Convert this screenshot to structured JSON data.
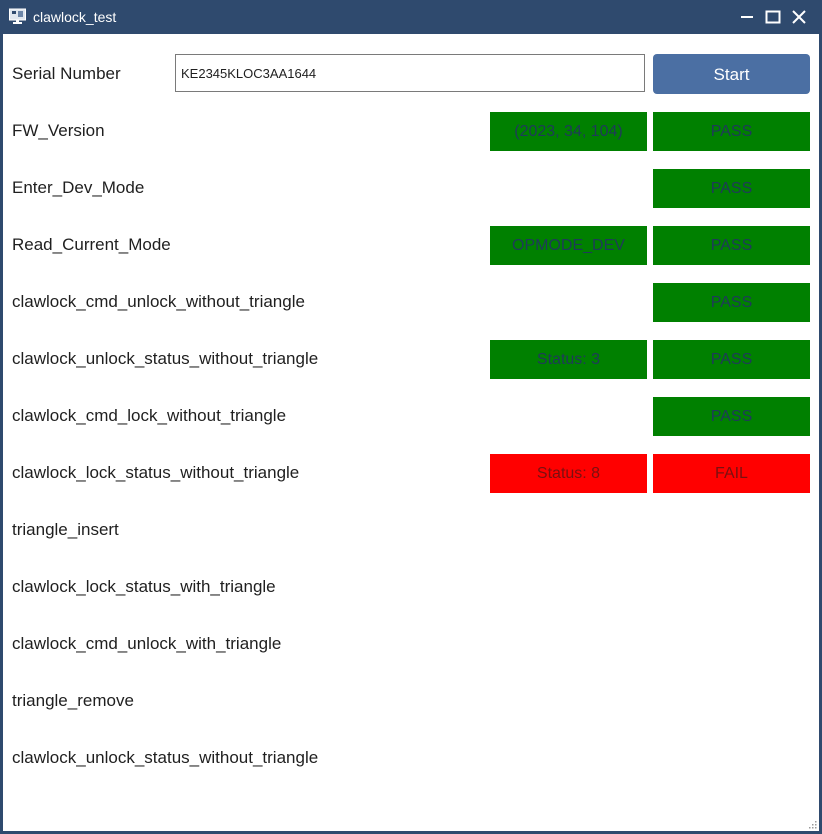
{
  "window": {
    "title": "clawlock_test",
    "icon": "app-monitor-icon",
    "controls": [
      "minimize-icon",
      "maximize-icon",
      "close-icon"
    ]
  },
  "serial": {
    "label": "Serial Number",
    "value": "KE2345KLOC3AA1644",
    "start_label": "Start"
  },
  "tests": [
    {
      "name": "FW_Version",
      "value": "(2023, 34, 104)",
      "result": "PASS"
    },
    {
      "name": "Enter_Dev_Mode",
      "value": "",
      "result": "PASS"
    },
    {
      "name": "Read_Current_Mode",
      "value": "OPMODE_DEV",
      "result": "PASS"
    },
    {
      "name": "clawlock_cmd_unlock_without_triangle",
      "value": "",
      "result": "PASS"
    },
    {
      "name": "clawlock_unlock_status_without_triangle",
      "value": "Status: 3",
      "result": "PASS"
    },
    {
      "name": "clawlock_cmd_lock_without_triangle",
      "value": "",
      "result": "PASS"
    },
    {
      "name": "clawlock_lock_status_without_triangle",
      "value": "Status: 8",
      "result": "FAIL"
    },
    {
      "name": "triangle_insert",
      "value": "",
      "result": ""
    },
    {
      "name": "clawlock_lock_status_with_triangle",
      "value": "",
      "result": ""
    },
    {
      "name": "clawlock_cmd_unlock_with_triangle",
      "value": "",
      "result": ""
    },
    {
      "name": "triangle_remove",
      "value": "",
      "result": ""
    },
    {
      "name": "clawlock_unlock_status_without_triangle",
      "value": "",
      "result": ""
    }
  ],
  "colors": {
    "pass": "#008000",
    "fail": "#ff0000",
    "titlebar": "#2f4a6e",
    "start_button": "#4b6fa3"
  }
}
